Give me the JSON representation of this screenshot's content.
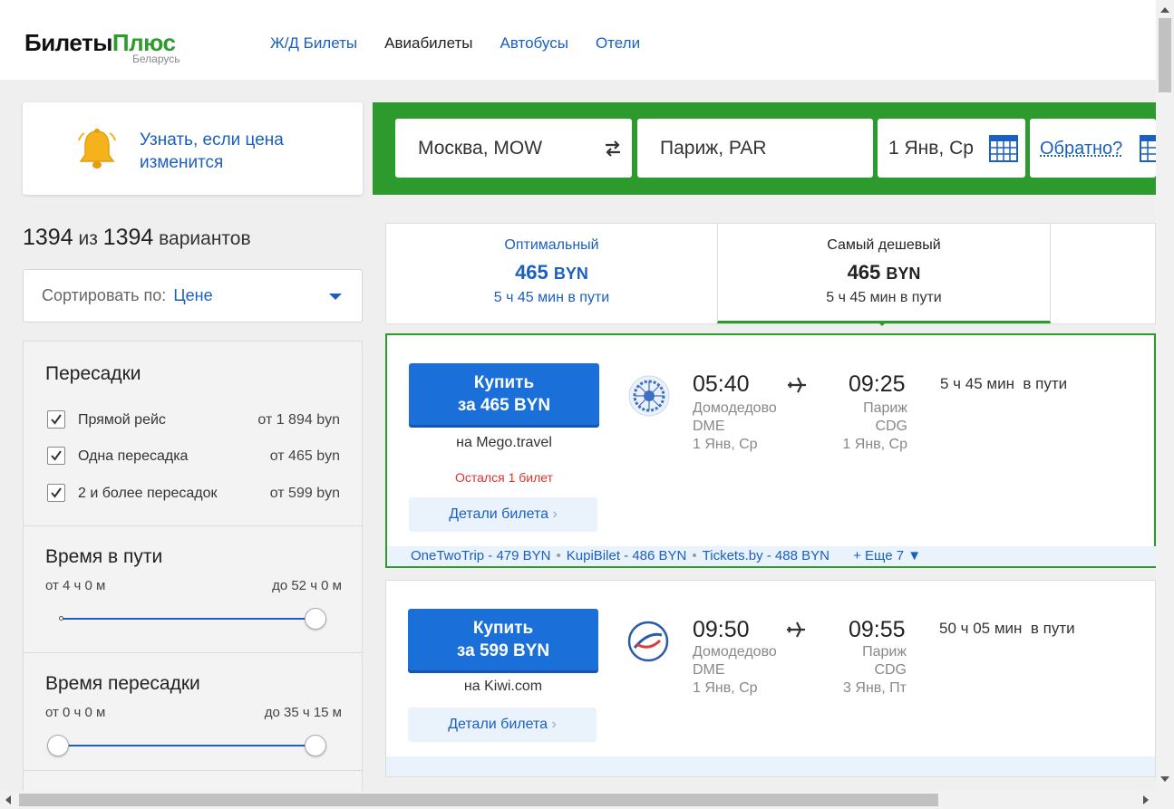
{
  "header": {
    "logo_part1": "Билеты",
    "logo_part2": "Плюс",
    "logo_sub": "Беларусь",
    "nav": [
      {
        "label": "Ж/Д Билеты"
      },
      {
        "label": "Авиабилеты",
        "active": true
      },
      {
        "label": "Автобусы"
      },
      {
        "label": "Отели"
      }
    ]
  },
  "notify": {
    "text": "Узнать, если цена изменится",
    "icon": "bell-icon"
  },
  "search": {
    "from": "Москва, MOW",
    "to": "Париж, PAR",
    "date": "1 Янв, Ср",
    "return_label": "Обратно?"
  },
  "results": {
    "shown": "1394",
    "of_word": "из",
    "total": "1394",
    "suffix_word": "вариантов"
  },
  "sort": {
    "label": "Сортировать по:",
    "value": "Цене"
  },
  "filters": {
    "transfers": {
      "title": "Пересадки",
      "items": [
        {
          "label": "Прямой рейс",
          "price": "от 1 894 byn",
          "checked": true
        },
        {
          "label": "Одна пересадка",
          "price": "от 465 byn",
          "checked": true
        },
        {
          "label": "2 и более пересадок",
          "price": "от 599 byn",
          "checked": true
        }
      ]
    },
    "travel_time": {
      "title": "Время в пути",
      "from": "от 4 ч 0 м",
      "to": "до 52 ч 0 м"
    },
    "transfer_time": {
      "title": "Время пересадки",
      "from": "от 0 ч 0 м",
      "to": "до 35 ч 15 м"
    }
  },
  "tabs": [
    {
      "title": "Оптимальный",
      "price": "465",
      "currency": "BYN",
      "duration": "5 ч 45 мин в пути"
    },
    {
      "title": "Самый дешевый",
      "price": "465",
      "currency": "BYN",
      "duration": "5 ч 45 мин в пути"
    }
  ],
  "tickets": [
    {
      "buy_line1": "Купить",
      "buy_line2": "за 465 BYN",
      "agent": "на Mego.travel",
      "warning": "Остался 1 билет",
      "details": "Детали билета",
      "dep_time": "05:40",
      "dep_airport": "Домодедово",
      "dep_code": "DME",
      "dep_date": "1 Янв, Ср",
      "arr_time": "09:25",
      "arr_city": "Париж",
      "arr_code": "CDG",
      "arr_date": "1 Янв, Ср",
      "duration": "5 ч 45 мин",
      "duration_suffix": "в пути",
      "alternatives": [
        "OneTwoTrip - 479 BYN",
        "KupiBilet - 486 BYN",
        "Tickets.by - 488 BYN"
      ],
      "more": "+ Еще 7 ▼"
    },
    {
      "buy_line1": "Купить",
      "buy_line2": "за 599 BYN",
      "agent": "на Kiwi.com",
      "details": "Детали билета",
      "dep_time": "09:50",
      "dep_airport": "Домодедово",
      "dep_code": "DME",
      "dep_date": "1 Янв, Ср",
      "arr_time": "09:55",
      "arr_city": "Париж",
      "arr_code": "CDG",
      "arr_date": "3 Янв, Пт",
      "duration": "50 ч 05 мин",
      "duration_suffix": "в пути"
    }
  ]
}
